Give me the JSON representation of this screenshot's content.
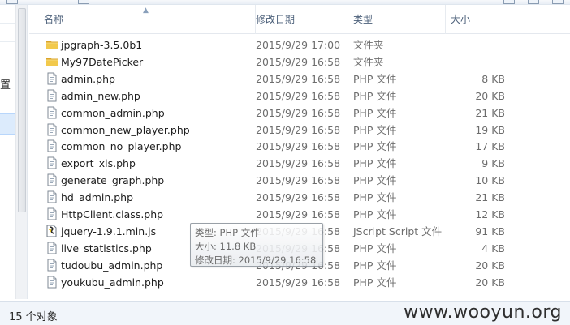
{
  "columns": {
    "name": "名称",
    "date": "修改日期",
    "type": "类型",
    "size": "大小"
  },
  "nav": {
    "visible_label": "置"
  },
  "files": [
    {
      "name": "jpgraph-3.5.0b1",
      "date": "2015/9/29 17:00",
      "type": "文件夹",
      "size": "",
      "icon": "folder-icon"
    },
    {
      "name": "My97DatePicker",
      "date": "2015/9/29 16:58",
      "type": "文件夹",
      "size": "",
      "icon": "folder-icon"
    },
    {
      "name": "admin.php",
      "date": "2015/9/29 16:58",
      "type": "PHP 文件",
      "size": "8 KB",
      "icon": "php-file-icon"
    },
    {
      "name": "admin_new.php",
      "date": "2015/9/29 16:58",
      "type": "PHP 文件",
      "size": "20 KB",
      "icon": "php-file-icon"
    },
    {
      "name": "common_admin.php",
      "date": "2015/9/29 16:58",
      "type": "PHP 文件",
      "size": "21 KB",
      "icon": "php-file-icon"
    },
    {
      "name": "common_new_player.php",
      "date": "2015/9/29 16:58",
      "type": "PHP 文件",
      "size": "19 KB",
      "icon": "php-file-icon"
    },
    {
      "name": "common_no_player.php",
      "date": "2015/9/29 16:58",
      "type": "PHP 文件",
      "size": "17 KB",
      "icon": "php-file-icon"
    },
    {
      "name": "export_xls.php",
      "date": "2015/9/29 16:58",
      "type": "PHP 文件",
      "size": "9 KB",
      "icon": "php-file-icon"
    },
    {
      "name": "generate_graph.php",
      "date": "2015/9/29 16:58",
      "type": "PHP 文件",
      "size": "10 KB",
      "icon": "php-file-icon"
    },
    {
      "name": "hd_admin.php",
      "date": "2015/9/29 16:58",
      "type": "PHP 文件",
      "size": "21 KB",
      "icon": "php-file-icon"
    },
    {
      "name": "HttpClient.class.php",
      "date": "2015/9/29 16:58",
      "type": "PHP 文件",
      "size": "12 KB",
      "icon": "php-file-icon"
    },
    {
      "name": "jquery-1.9.1.min.js",
      "date": "2015/9/29 16:58",
      "type": "JScript Script 文件",
      "size": "91 KB",
      "icon": "jscript-file-icon"
    },
    {
      "name": "live_statistics.php",
      "date": "2015/9/29 16:58",
      "type": "PHP 文件",
      "size": "4 KB",
      "icon": "php-file-icon"
    },
    {
      "name": "tudoubu_admin.php",
      "date": "2015/9/29 16:58",
      "type": "PHP 文件",
      "size": "20 KB",
      "icon": "php-file-icon"
    },
    {
      "name": "youkubu_admin.php",
      "date": "2015/9/29 16:58",
      "type": "PHP 文件",
      "size": "20 KB",
      "icon": "php-file-icon"
    }
  ],
  "tooltip": {
    "type_line": "类型: PHP 文件",
    "size_line": "大小: 11.8 KB",
    "date_line": "修改日期: 2015/9/29 16:58"
  },
  "status": {
    "count": "15 个对象"
  },
  "watermark": "www.wooyun.org",
  "colors": {
    "folder": "#e8b830",
    "header_text": "#4c607a",
    "selection": "#dcebfc"
  }
}
